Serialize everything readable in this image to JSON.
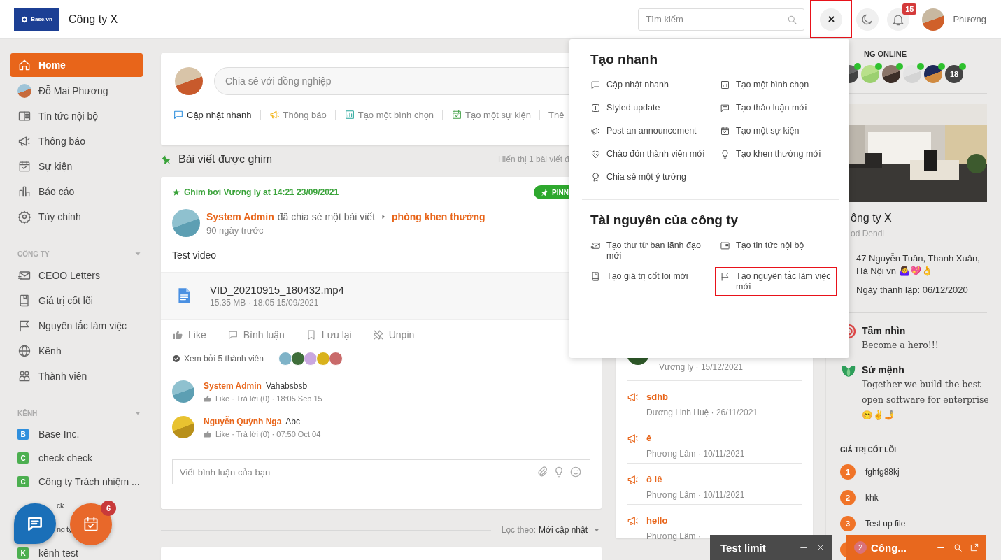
{
  "header": {
    "logo": "Base.vn",
    "company": "Công ty X",
    "search": {
      "placeholder": "Tìm kiếm"
    },
    "close_button": {
      "label": "×",
      "highlighted": true
    },
    "notifications": {
      "count": "15"
    },
    "user": "Phương"
  },
  "sidebar": {
    "nav": [
      {
        "label": "Home",
        "selected": true
      },
      {
        "label": "Đỗ Mai Phương",
        "selected": false
      },
      {
        "label": "Tin tức nội bộ",
        "selected": false
      },
      {
        "label": "Thông báo",
        "selected": false
      },
      {
        "label": "Sự kiện",
        "selected": false
      },
      {
        "label": "Báo cáo",
        "selected": false
      },
      {
        "label": "Tùy chỉnh",
        "selected": false
      }
    ],
    "sections": [
      {
        "title": "CÔNG TY",
        "kind": "pages",
        "expanded": true,
        "items": [
          {
            "label": "CEOO Letters"
          },
          {
            "label": "Giá trị cốt lõi"
          },
          {
            "label": "Nguyên tắc làm việc"
          },
          {
            "label": "Kênh"
          },
          {
            "label": "Thành viên"
          }
        ]
      },
      {
        "title": "KÊNH",
        "kind": "channels",
        "expanded": true,
        "items": [
          {
            "label": "Base Inc.",
            "letter": "B",
            "color": "#2f8fdd"
          },
          {
            "label": "check check",
            "letter": "C",
            "color": "#4caf50"
          },
          {
            "label": "Công ty Trách nhiệm ...",
            "letter": "C",
            "color": "#4caf50"
          },
          {
            "label": "ck"
          },
          {
            "label": "ng ty"
          },
          {
            "label": "kênh test",
            "letter": "K",
            "color": "#4caf50"
          }
        ]
      }
    ]
  },
  "fab": {
    "tasks_badge": "6"
  },
  "composer": {
    "placeholder": "Chia sẻ với đồng nghiệp",
    "actions": [
      "Cập nhật nhanh",
      "Thông báo",
      "Tạo một bình chọn",
      "Tạo một sự kiện",
      "Thê"
    ]
  },
  "pinned": {
    "title": "Bài viết được ghim",
    "note": "Hiển thị 1 bài viết đ"
  },
  "post": {
    "pinned_by": "Ghim bởi Vương ly at 14:21 23/09/2021",
    "badge": "PINN",
    "author": "System Admin",
    "action": "đã chia sẻ một bài viết",
    "target": "phòng khen thưởng",
    "time": "90 ngày trước",
    "body": "Test video",
    "attachment": {
      "name": "VID_20210915_180432.mp4",
      "meta": "15.35 MB · 18:05 15/09/2021"
    },
    "actions": [
      "Like",
      "Bình luận",
      "Lưu lại",
      "Unpin"
    ],
    "seen": "Xem bởi 5 thành viên",
    "viewers": [
      {
        "color": "#7fb3c8"
      },
      {
        "color": "#3f6e3a"
      },
      {
        "color": "#c9a7e0"
      },
      {
        "color": "#d9b21c"
      },
      {
        "color": "#c96a6a"
      }
    ],
    "comments": [
      {
        "author": "System Admin",
        "text": "Vahabsbsb",
        "meta": "Like · Trả lời (0) · 18:05 Sep 15"
      },
      {
        "author": "Nguyễn Quỳnh Nga",
        "text": "Abc",
        "meta": "Like · Trả lời (0) · 07:50 Oct 04"
      }
    ],
    "comment_placeholder": "Viết bình luận của bạn"
  },
  "filter": {
    "label": "Lọc theo:",
    "value": "Mới cập nhật"
  },
  "middle": {
    "first_meta": "Vương ly · 15/12/2021",
    "announcements": [
      {
        "title": "sdhb",
        "meta": "Dương Linh Huệ · 26/11/2021"
      },
      {
        "title": "ê",
        "meta": "Phương Lâm · 10/11/2021"
      },
      {
        "title": "ô lê",
        "meta": "Phương Lâm · 10/11/2021"
      },
      {
        "title": "hello",
        "meta": "Phương Lâm ·"
      }
    ]
  },
  "right": {
    "online_title": "NG ONLINE",
    "online_more": "18",
    "company": "ông ty X",
    "subtitle": "od Dendi",
    "address": "47 Nguyễn Tuân, Thanh Xuân, Hà Nội vn 🤷‍♀️💖👌",
    "founded": "Ngày thành lập: 06/12/2020",
    "vision": {
      "title": "Tầm nhìn",
      "text": "Become a hero!!!"
    },
    "mission": {
      "title": "Sứ mệnh",
      "text": "Together we build the best open software for enterprise 😊✌️🤳"
    },
    "values_title": "GIÁ TRỊ CỐT LÕI",
    "values": [
      {
        "number": "1",
        "text": "fghfg88kj"
      },
      {
        "number": "2",
        "text": "khk"
      },
      {
        "number": "3",
        "text": "Test up file"
      }
    ]
  },
  "dropdown": {
    "sections": [
      {
        "title": "Tạo nhanh",
        "items": [
          {
            "label": "Cập nhật nhanh",
            "highlighted": false
          },
          {
            "label": "Tạo một bình chọn",
            "highlighted": false
          },
          {
            "label": "Styled update",
            "highlighted": false
          },
          {
            "label": "Tạo thảo luận mới",
            "highlighted": false
          },
          {
            "label": "Post an announcement",
            "highlighted": false
          },
          {
            "label": "Tạo một sự kiện",
            "highlighted": false
          },
          {
            "label": "Chào đón thành viên mới",
            "highlighted": false
          },
          {
            "label": "Tạo khen thưởng mới",
            "highlighted": false
          },
          {
            "label": "Chia sẻ một ý tưởng",
            "highlighted": false
          }
        ]
      },
      {
        "title": "Tài nguyên của công ty",
        "items": [
          {
            "label": "Tạo thư từ ban lãnh đạo mới",
            "highlighted": false
          },
          {
            "label": "Tạo tin tức nội bộ",
            "highlighted": false
          },
          {
            "label": "Tạo giá trị cốt lõi mới",
            "highlighted": false
          },
          {
            "label": "Tạo nguyên tắc làm việc mới",
            "highlighted": true
          }
        ]
      }
    ]
  },
  "chats": [
    {
      "title": "Test limit",
      "kind": "dark"
    },
    {
      "title": "Công...",
      "kind": "orange",
      "badge": "2"
    }
  ]
}
